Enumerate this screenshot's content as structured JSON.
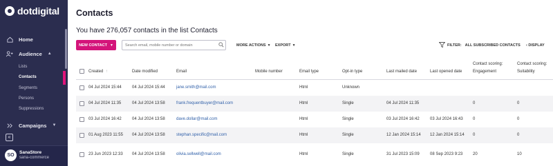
{
  "brand": {
    "name": "dotdigital"
  },
  "sidebar": {
    "home": "Home",
    "audience": "Audience",
    "audience_sub": [
      "Lists",
      "Contacts",
      "Segments",
      "Persons",
      "Suppressions"
    ],
    "campaigns": "Campaigns",
    "collapse": "«",
    "account": {
      "initials": "SO",
      "name": "SanaStore",
      "subtitle": "sana-commerce"
    }
  },
  "page": {
    "title": "Contacts",
    "summary": "You have 276,057 contacts in the list Contacts"
  },
  "toolbar": {
    "new_contact": "NEW CONTACT",
    "search_placeholder": "Search email, mobile number or domain",
    "more_actions": "MORE ACTIONS",
    "export": "EXPORT",
    "filter_label": "FILTER:",
    "filter_value": "ALL SUBSCRIBED CONTACTS",
    "display": "DISPLAY"
  },
  "table": {
    "headers": {
      "created": "Created",
      "date_modified": "Date modified",
      "email": "Email",
      "mobile": "Mobile number",
      "email_type": "Email type",
      "optin": "Opt-in type",
      "last_mailed": "Last mailed date",
      "last_opened": "Last opened date",
      "engagement_1": "Contact scoring:",
      "engagement_2": "Engagement",
      "suitability_1": "Contact scoring:",
      "suitability_2": "Suitability"
    },
    "rows": [
      {
        "created": "04 Jul 2024 15:44",
        "modified": "04 Jul 2024 15:44",
        "email": "jane.smith@mail.com",
        "mobile": "",
        "type": "Html",
        "optin": "Unknown",
        "mailed": "",
        "opened": "",
        "engagement": "",
        "suitability": ""
      },
      {
        "created": "04 Jul 2024 11:35",
        "modified": "04 Jul 2024 13:58",
        "email": "frank.frequentbuyer@mail.com",
        "mobile": "",
        "type": "Html",
        "optin": "Single",
        "mailed": "04 Jul 2024 11:35",
        "opened": "",
        "engagement": "0",
        "suitability": "0"
      },
      {
        "created": "03 Jul 2024 16:42",
        "modified": "04 Jul 2024 13:58",
        "email": "dave.dollar@mail.com",
        "mobile": "",
        "type": "Html",
        "optin": "Single",
        "mailed": "03 Jul 2024 16:42",
        "opened": "03 Jul 2024 16:43",
        "engagement": "0",
        "suitability": "0"
      },
      {
        "created": "01 Aug 2023 11:55",
        "modified": "04 Jul 2024 13:58",
        "email": "stephan.specific@mail.com",
        "mobile": "",
        "type": "Html",
        "optin": "Single",
        "mailed": "12 Jan 2024 15:14",
        "opened": "12 Jan 2024 15:14",
        "engagement": "0",
        "suitability": "0"
      },
      {
        "created": "23 Jun 2023 12:33",
        "modified": "04 Jul 2024 13:58",
        "email": "olivia.sellwell@mail.com",
        "mobile": "",
        "type": "Html",
        "optin": "Single",
        "mailed": "31 Jul 2023 15:09",
        "opened": "08 Sep 2023 9:23",
        "engagement": "20",
        "suitability": "10"
      }
    ]
  },
  "colors": {
    "sidebar": "#2b2d4f",
    "accent": "#d4147a",
    "link": "#2f5fa8"
  }
}
